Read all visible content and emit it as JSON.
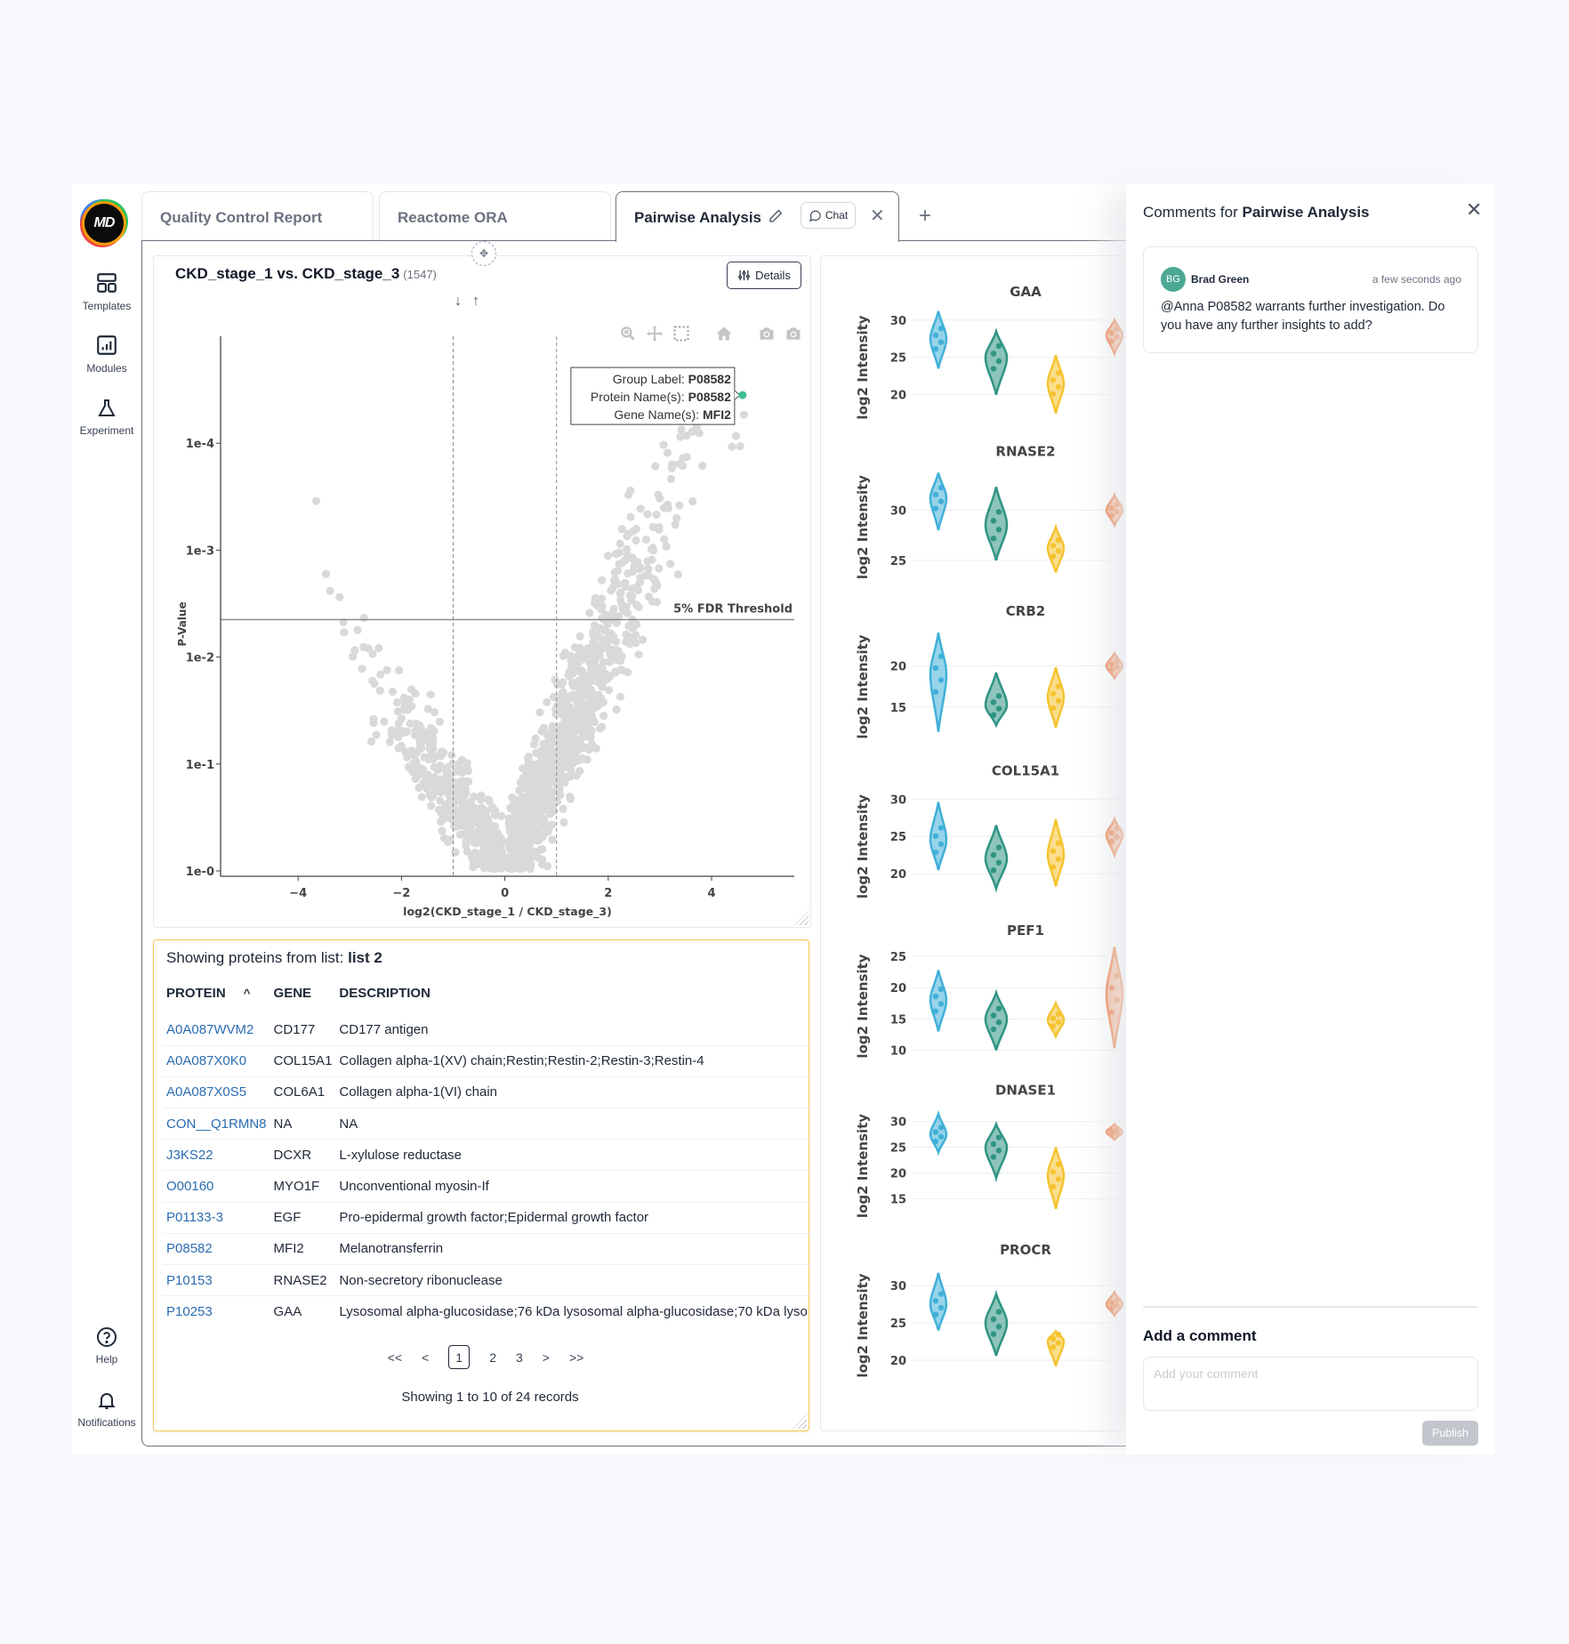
{
  "sidebar": {
    "logo_text": "MD",
    "items": [
      {
        "label": "Templates",
        "icon": "templates-icon"
      },
      {
        "label": "Modules",
        "icon": "bar-chart-icon"
      },
      {
        "label": "Experiment",
        "icon": "flask-icon"
      }
    ],
    "bottom_items": [
      {
        "label": "Help",
        "icon": "help-icon"
      },
      {
        "label": "Notifications",
        "icon": "bell-icon"
      }
    ]
  },
  "tabs": [
    {
      "label": "Quality Control Report",
      "active": false
    },
    {
      "label": "Reactome ORA",
      "active": false
    },
    {
      "label": "Pairwise Analysis",
      "active": true
    }
  ],
  "active_tab": {
    "chat_label": "Chat",
    "add_tab_label": "+"
  },
  "volcano_panel": {
    "title": "CKD_stage_1 vs. CKD_stage_3",
    "count": "(1547)",
    "details_label": "Details",
    "tooltip": {
      "group_label_key": "Group Label: ",
      "group_label_value": "P08582",
      "protein_key": "Protein Name(s): ",
      "protein_value": "P08582",
      "gene_key": "Gene Name(s): ",
      "gene_value": "MFI2"
    }
  },
  "chart_data": [
    {
      "type": "scatter",
      "title": "CKD_stage_1 vs. CKD_stage_3",
      "xlabel": "log2(CKD_stage_1 / CKD_stage_3)",
      "ylabel": "P-Value",
      "xlim": [
        -5.5,
        5.6
      ],
      "ylim_log10_neg": [
        -0.05,
        5.0
      ],
      "x_ticks": [
        -4,
        -2,
        0,
        2,
        4
      ],
      "x_tick_labels": [
        "−4",
        "−2",
        "0",
        "2",
        "4"
      ],
      "y_ticks_neglog10": [
        0,
        1,
        2,
        3,
        4
      ],
      "y_tick_labels": [
        "1e-0",
        "1e-1",
        "1e-2",
        "1e-3",
        "1e-4"
      ],
      "fold_change_cutoffs": [
        -1,
        1
      ],
      "fdr_threshold_neglog10p": 2.35,
      "fdr_label": "5% FDR Threshold",
      "n_points": 1547,
      "point_color": "#d9d9d9",
      "highlight": {
        "label": "P08582",
        "x": 4.6,
        "neglog10p": 4.45,
        "color": "#3fbf8f"
      },
      "grid": false
    },
    {
      "type": "violin",
      "ylabel": "log2 Intensity",
      "group_colors": [
        "#41b0d8",
        "#2f9483",
        "#f5c330",
        "#ec7030"
      ],
      "panels": [
        {
          "title": "GAA",
          "y_ticks": [
            20,
            25,
            30
          ],
          "ylim": [
            16.5,
            32
          ],
          "groups": [
            {
              "center": 27.5,
              "min": 23.5,
              "max": 31.2
            },
            {
              "center": 25,
              "min": 20,
              "max": 28.5
            },
            {
              "center": 21.5,
              "min": 17.5,
              "max": 25.3
            },
            {
              "center": 28,
              "min": 25.5,
              "max": 30
            }
          ]
        },
        {
          "title": "RNASE2",
          "y_ticks": [
            25,
            30
          ],
          "ylim": [
            23,
            34.5
          ],
          "groups": [
            {
              "center": 31.2,
              "min": 28,
              "max": 33.7
            },
            {
              "center": 28.5,
              "min": 25,
              "max": 32.3
            },
            {
              "center": 26.2,
              "min": 23.8,
              "max": 28.3
            },
            {
              "center": 30,
              "min": 28.5,
              "max": 31.5
            }
          ]
        },
        {
          "title": "CRB2",
          "y_ticks": [
            15,
            20
          ],
          "ylim": [
            11,
            25
          ],
          "groups": [
            {
              "center": 19,
              "min": 12,
              "max": 24
            },
            {
              "center": 15.2,
              "min": 12.8,
              "max": 19.2
            },
            {
              "center": 16.2,
              "min": 12.5,
              "max": 19.8
            },
            {
              "center": 20,
              "min": 18.5,
              "max": 21.5
            }
          ]
        },
        {
          "title": "COL15A1",
          "y_ticks": [
            20,
            25,
            30
          ],
          "ylim": [
            16.5,
            32
          ],
          "groups": [
            {
              "center": 24.5,
              "min": 20.5,
              "max": 29.6
            },
            {
              "center": 22,
              "min": 18,
              "max": 26.5
            },
            {
              "center": 22.5,
              "min": 18.3,
              "max": 27.3
            },
            {
              "center": 25.2,
              "min": 22.5,
              "max": 27.3
            }
          ]
        },
        {
          "title": "PEF1",
          "y_ticks": [
            10,
            15,
            20,
            25
          ],
          "ylim": [
            8.5,
            27
          ],
          "groups": [
            {
              "center": 18,
              "min": 13,
              "max": 22.8
            },
            {
              "center": 15,
              "min": 10,
              "max": 19.2
            },
            {
              "center": 14.8,
              "min": 12.2,
              "max": 17.5
            },
            {
              "center": 19,
              "min": 10.3,
              "max": 26.5
            }
          ]
        },
        {
          "title": "DNASE1",
          "y_ticks": [
            15,
            20,
            25,
            30
          ],
          "ylim": [
            11,
            33.5
          ],
          "groups": [
            {
              "center": 27.5,
              "min": 24,
              "max": 31.5
            },
            {
              "center": 25,
              "min": 19,
              "max": 29.5
            },
            {
              "center": 19.5,
              "min": 13,
              "max": 25
            },
            {
              "center": 28,
              "min": 26.5,
              "max": 29.5
            }
          ]
        },
        {
          "title": "PROCR",
          "y_ticks": [
            20,
            25,
            30
          ],
          "ylim": [
            17.5,
            33
          ],
          "groups": [
            {
              "center": 27.5,
              "min": 24,
              "max": 31.7
            },
            {
              "center": 25,
              "min": 20.6,
              "max": 28.9
            },
            {
              "center": 22.6,
              "min": 19.2,
              "max": 23.9
            },
            {
              "center": 27.5,
              "min": 26,
              "max": 29.1
            }
          ]
        }
      ]
    }
  ],
  "protein_table": {
    "caption_prefix": "Showing proteins from list: ",
    "list_name": "list 2",
    "columns": [
      "PROTEIN",
      "GENE",
      "DESCRIPTION"
    ],
    "sort_indicator": "^",
    "rows": [
      {
        "protein": "A0A087WVM2",
        "gene": "CD177",
        "description": "CD177 antigen"
      },
      {
        "protein": "A0A087X0K0",
        "gene": "COL15A1",
        "description": "Collagen alpha-1(XV) chain;Restin;Restin-2;Restin-3;Restin-4"
      },
      {
        "protein": "A0A087X0S5",
        "gene": "COL6A1",
        "description": "Collagen alpha-1(VI) chain"
      },
      {
        "protein": "CON__Q1RMN8",
        "gene": "NA",
        "description": "NA"
      },
      {
        "protein": "J3KS22",
        "gene": "DCXR",
        "description": "L-xylulose reductase"
      },
      {
        "protein": "O00160",
        "gene": "MYO1F",
        "description": "Unconventional myosin-If"
      },
      {
        "protein": "P01133-3",
        "gene": "EGF",
        "description": "Pro-epidermal growth factor;Epidermal growth factor"
      },
      {
        "protein": "P08582",
        "gene": "MFI2",
        "description": "Melanotransferrin"
      },
      {
        "protein": "P10153",
        "gene": "RNASE2",
        "description": "Non-secretory ribonuclease"
      },
      {
        "protein": "P10253",
        "gene": "GAA",
        "description": "Lysosomal alpha-glucosidase;76 kDa lysosomal alpha-glucosidase;70 kDa lyso"
      }
    ],
    "pagination": {
      "first": "<<",
      "prev": "<",
      "pages": [
        "1",
        "2",
        "3"
      ],
      "current_page": "1",
      "next": ">",
      "last": ">>"
    },
    "summary": "Showing 1 to 10 of 24 records"
  },
  "comments_panel": {
    "title_prefix": "Comments for ",
    "title_target": "Pairwise Analysis",
    "comments": [
      {
        "initials": "BG",
        "author": "Brad Green",
        "time": "a few seconds ago",
        "body": "@Anna P08582 warrants further investigation. Do you have any further insights to add?"
      }
    ],
    "add_label": "Add a comment",
    "input_placeholder": "Add your comment",
    "input_value": "",
    "publish_label": "Publish"
  },
  "colors": {
    "accent_link": "#2b6cb0",
    "avatar": "#4aa893",
    "table_highlight_border": "#f5c84c"
  }
}
